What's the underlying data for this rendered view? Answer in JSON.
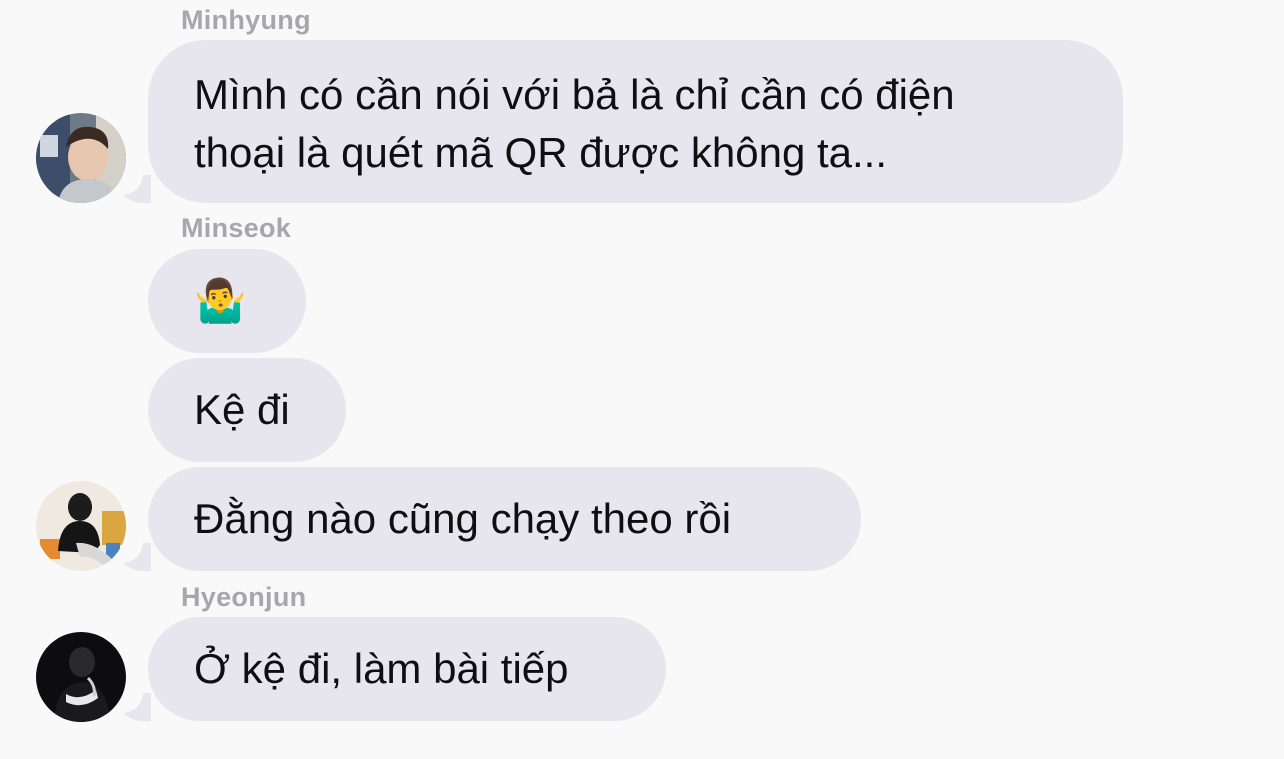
{
  "conversation": {
    "groups": [
      {
        "sender": "Minhyung",
        "avatar_icon": "profile-photo-icon",
        "messages": [
          "Mình có cần nói với bả là chỉ cần có điện\nthoại là quét mã QR được không ta..."
        ]
      },
      {
        "sender": "Minseok",
        "avatar_icon": "profile-photo-icon",
        "messages": [
          "🤷‍♂️",
          "Kệ đi",
          "Đằng nào cũng chạy theo rồi"
        ]
      },
      {
        "sender": "Hyeonjun",
        "avatar_icon": "profile-photo-icon",
        "messages": [
          "Ở kệ đi, làm bài tiếp"
        ]
      }
    ]
  },
  "colors": {
    "background": "#f9f9fa",
    "bubble": "#e7e5ed",
    "sender_name": "#a7a7aa",
    "text": "#0f0f12"
  }
}
